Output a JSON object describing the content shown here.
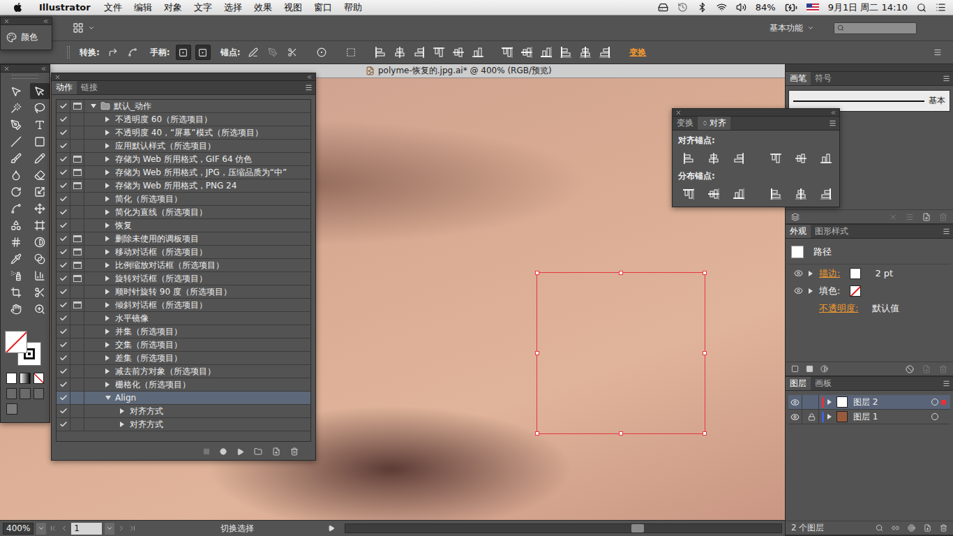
{
  "menubar": {
    "app": "Illustrator",
    "menus": [
      "文件",
      "编辑",
      "对象",
      "文字",
      "选择",
      "效果",
      "视图",
      "窗口",
      "帮助"
    ],
    "battery": "84%",
    "clock": "9月1日 周二 14:10"
  },
  "color_panel": {
    "title": "颜色"
  },
  "appbar": {
    "workspace": "基本功能"
  },
  "control_bar": {
    "convert": "转换:",
    "handles": "手柄:",
    "anchors": "锚点:",
    "transform": "变换"
  },
  "document": {
    "title": "polyme-恢复的.jpg.ai* @ 400% (RGB/预览)",
    "selection_box": true
  },
  "actions_panel": {
    "tabs": [
      {
        "label": "动作",
        "selected": true
      },
      {
        "label": "链接",
        "selected": false
      }
    ],
    "rows": [
      {
        "kind": "set",
        "label": "默认_动作",
        "checked": true,
        "dialog": true,
        "expanded": true,
        "selected": false
      },
      {
        "kind": "action",
        "label": "不透明度 60（所选项目）",
        "checked": true,
        "dialog": false,
        "expanded": false,
        "selected": false
      },
      {
        "kind": "action",
        "label": "不透明度 40，“屏幕”模式（所选项目）",
        "checked": true,
        "dialog": false,
        "expanded": false,
        "selected": false
      },
      {
        "kind": "action",
        "label": "应用默认样式（所选项目）",
        "checked": true,
        "dialog": false,
        "expanded": false,
        "selected": false
      },
      {
        "kind": "action",
        "label": "存储为 Web 所用格式，GIF 64 仿色",
        "checked": true,
        "dialog": true,
        "expanded": false,
        "selected": false
      },
      {
        "kind": "action",
        "label": "存储为 Web 所用格式，JPG，压缩品质为“中”",
        "checked": true,
        "dialog": true,
        "expanded": false,
        "selected": false
      },
      {
        "kind": "action",
        "label": "存储为 Web 所用格式，PNG 24",
        "checked": true,
        "dialog": true,
        "expanded": false,
        "selected": false
      },
      {
        "kind": "action",
        "label": "简化（所选项目）",
        "checked": true,
        "dialog": false,
        "expanded": false,
        "selected": false
      },
      {
        "kind": "action",
        "label": "简化为直线（所选项目）",
        "checked": true,
        "dialog": false,
        "expanded": false,
        "selected": false
      },
      {
        "kind": "action",
        "label": "恢复",
        "checked": true,
        "dialog": false,
        "expanded": false,
        "selected": false
      },
      {
        "kind": "action",
        "label": "删除未使用的调板项目",
        "checked": true,
        "dialog": true,
        "expanded": false,
        "selected": false
      },
      {
        "kind": "action",
        "label": "移动对话框（所选项目）",
        "checked": true,
        "dialog": true,
        "expanded": false,
        "selected": false
      },
      {
        "kind": "action",
        "label": "比例缩放对话框（所选项目）",
        "checked": true,
        "dialog": true,
        "expanded": false,
        "selected": false
      },
      {
        "kind": "action",
        "label": "旋转对话框（所选项目）",
        "checked": true,
        "dialog": true,
        "expanded": false,
        "selected": false
      },
      {
        "kind": "action",
        "label": "顺时针旋转 90 度（所选项目）",
        "checked": true,
        "dialog": false,
        "expanded": false,
        "selected": false
      },
      {
        "kind": "action",
        "label": "倾斜对话框（所选项目）",
        "checked": true,
        "dialog": true,
        "expanded": false,
        "selected": false
      },
      {
        "kind": "action",
        "label": "水平镜像",
        "checked": true,
        "dialog": false,
        "expanded": false,
        "selected": false
      },
      {
        "kind": "action",
        "label": "并集（所选项目）",
        "checked": true,
        "dialog": false,
        "expanded": false,
        "selected": false
      },
      {
        "kind": "action",
        "label": "交集（所选项目）",
        "checked": true,
        "dialog": false,
        "expanded": false,
        "selected": false
      },
      {
        "kind": "action",
        "label": "差集（所选项目）",
        "checked": true,
        "dialog": false,
        "expanded": false,
        "selected": false
      },
      {
        "kind": "action",
        "label": "减去前方对象（所选项目）",
        "checked": true,
        "dialog": false,
        "expanded": false,
        "selected": false
      },
      {
        "kind": "action",
        "label": "栅格化（所选项目）",
        "checked": true,
        "dialog": false,
        "expanded": false,
        "selected": false
      },
      {
        "kind": "action",
        "label": "Align",
        "checked": true,
        "dialog": false,
        "expanded": true,
        "selected": true
      },
      {
        "kind": "step",
        "label": "对齐方式",
        "checked": true,
        "dialog": false,
        "expanded": false,
        "selected": false
      },
      {
        "kind": "step",
        "label": "对齐方式",
        "checked": true,
        "dialog": false,
        "expanded": false,
        "selected": false
      }
    ]
  },
  "align_panel": {
    "tabs": [
      {
        "label": "变换",
        "selected": false
      },
      {
        "label": "对齐",
        "selected": true
      }
    ],
    "sections": [
      {
        "title": "对齐锚点:",
        "kind": "align"
      },
      {
        "title": "分布锚点:",
        "kind": "distribute"
      }
    ]
  },
  "brushes_panel": {
    "tabs": [
      {
        "label": "画笔",
        "selected": true
      },
      {
        "label": "符号",
        "selected": false
      }
    ],
    "brushes": [
      {
        "name": "基本"
      }
    ]
  },
  "appearance_panel": {
    "tabs": [
      {
        "label": "外观",
        "selected": true
      },
      {
        "label": "图形样式",
        "selected": false
      }
    ],
    "object": "路径",
    "attributes": [
      {
        "kind": "stroke",
        "label": "描边:",
        "link": true,
        "visible": true,
        "expandable": true,
        "swatch": "#ffffff",
        "value": "2 pt"
      },
      {
        "kind": "fill",
        "label": "填色:",
        "link": false,
        "visible": true,
        "expandable": true,
        "swatch": "none"
      },
      {
        "kind": "opacity",
        "label": "不透明度:",
        "link": true,
        "visible": false,
        "expandable": false,
        "value": "默认值"
      }
    ]
  },
  "layers_panel": {
    "tabs": [
      {
        "label": "图层",
        "selected": true
      },
      {
        "label": "画板",
        "selected": false
      }
    ],
    "layers": [
      {
        "name": "图层 2",
        "visible": true,
        "locked": false,
        "selected": true,
        "targeted": true,
        "color": "#e8303a",
        "thumb_color": "#ffffff"
      },
      {
        "name": "图层 1",
        "visible": true,
        "locked": true,
        "selected": false,
        "targeted": false,
        "color": "#3f62e0",
        "thumb_color": "#9a5a3c"
      }
    ],
    "count": "2 个图层"
  },
  "status_bar": {
    "zoom": "400%",
    "artboard": "1",
    "info": "切换选择"
  }
}
